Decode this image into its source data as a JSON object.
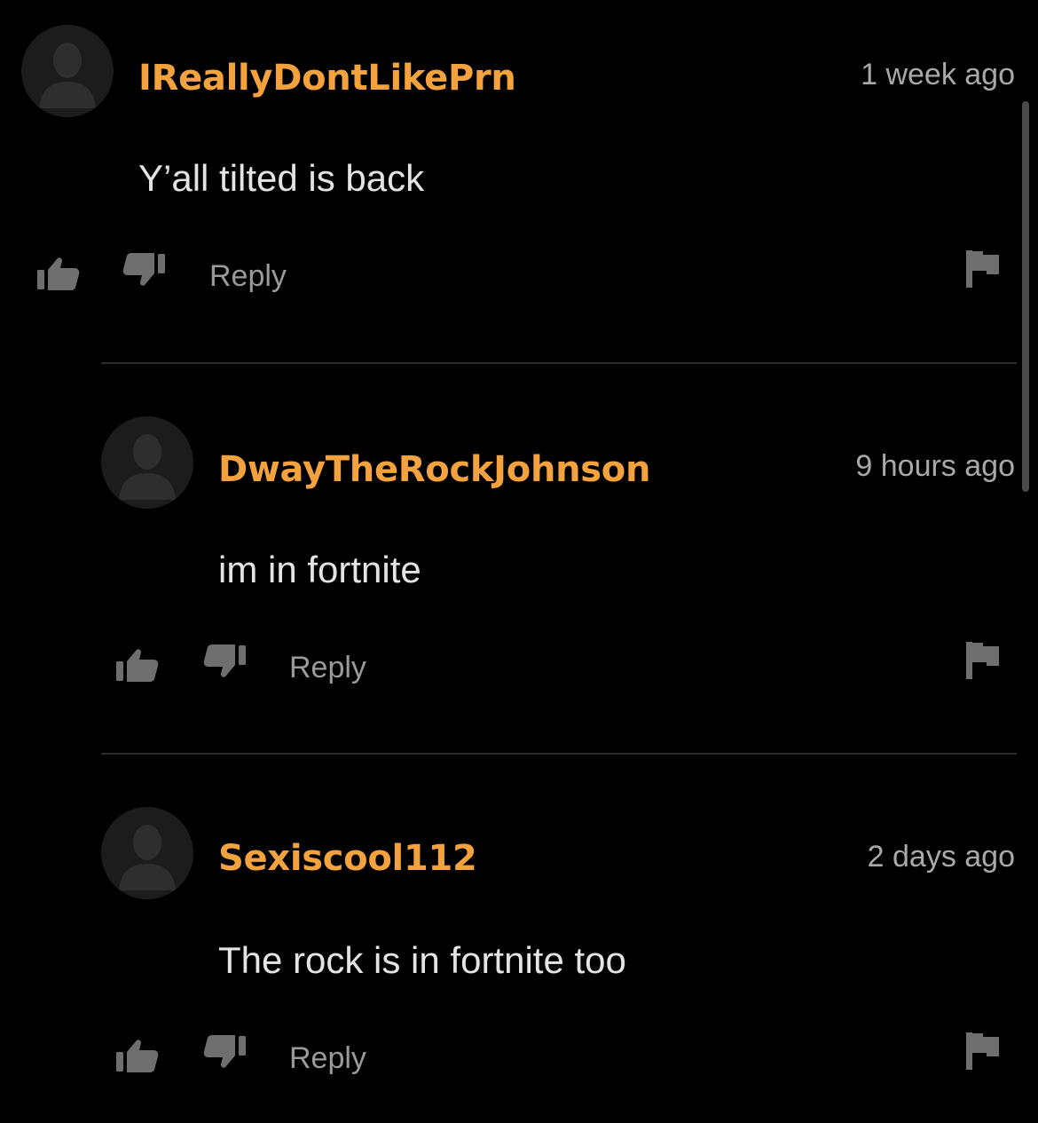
{
  "comments": [
    {
      "username": "IReallyDontLikePrn",
      "timestamp": "1 week ago",
      "text": "Y’all tilted is back",
      "reply_label": "Reply"
    },
    {
      "username": "DwayTheRockJohnson",
      "timestamp": "9 hours ago",
      "text": "im in fortnite",
      "reply_label": "Reply"
    },
    {
      "username": "Sexiscool112",
      "timestamp": "2 days ago",
      "text": "The rock is in fortnite too",
      "reply_label": "Reply"
    }
  ],
  "icons": {
    "avatar": "default-avatar-icon",
    "like": "thumbs-up-icon",
    "dislike": "thumbs-down-icon",
    "flag": "flag-icon"
  },
  "colors": {
    "background": "#000000",
    "username": "#f3a23d",
    "text": "#e4e4e4",
    "muted": "#9a9a9a",
    "icon": "#6f6f6f"
  }
}
